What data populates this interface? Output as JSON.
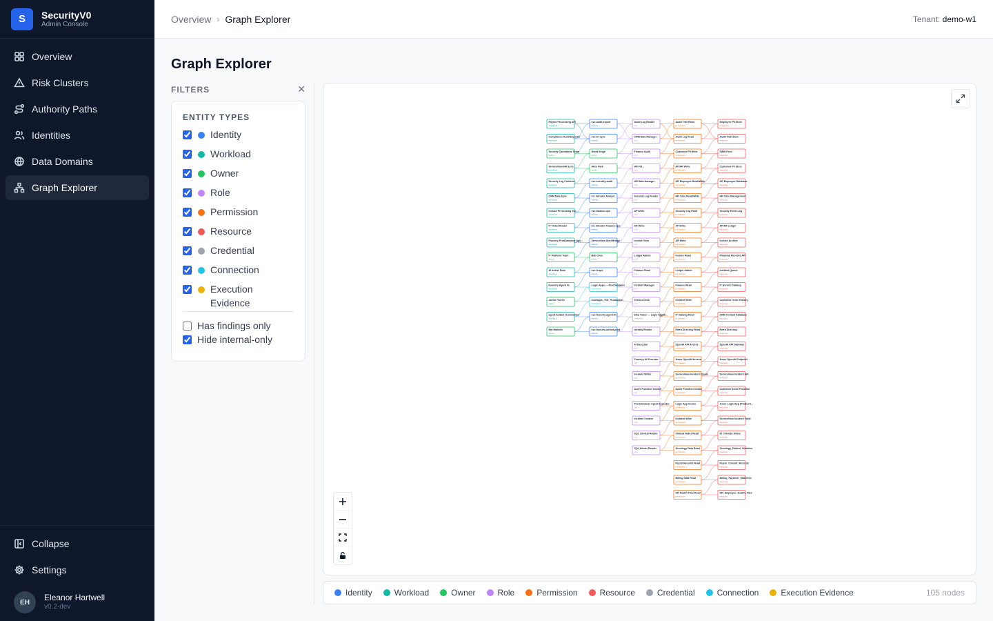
{
  "brand": {
    "logo_letter": "S",
    "name": "SecurityV0",
    "subtitle": "Admin Console"
  },
  "nav": [
    {
      "label": "Overview",
      "icon": "grid-icon",
      "active": false
    },
    {
      "label": "Risk Clusters",
      "icon": "warning-triangle-icon",
      "active": false
    },
    {
      "label": "Authority Paths",
      "icon": "route-icon",
      "active": false
    },
    {
      "label": "Identities",
      "icon": "users-icon",
      "active": false
    },
    {
      "label": "Data Domains",
      "icon": "globe-icon",
      "active": false
    },
    {
      "label": "Graph Explorer",
      "icon": "graph-icon",
      "active": true
    }
  ],
  "sidebar_bottom": {
    "collapse": "Collapse",
    "settings": "Settings"
  },
  "user": {
    "initials": "EH",
    "name": "Eleanor Hartwell",
    "version": "v0.2-dev"
  },
  "header": {
    "breadcrumb_root": "Overview",
    "breadcrumb_current": "Graph Explorer",
    "tenant_label": "Tenant:",
    "tenant_value": "demo-w1"
  },
  "page": {
    "title": "Graph Explorer"
  },
  "filters": {
    "title": "FILTERS",
    "entity_types_title": "ENTITY TYPES",
    "types": [
      {
        "label": "Identity",
        "color": "#3b82f6",
        "checked": true
      },
      {
        "label": "Workload",
        "color": "#14b8a6",
        "checked": true
      },
      {
        "label": "Owner",
        "color": "#22c55e",
        "checked": true
      },
      {
        "label": "Role",
        "color": "#c084fc",
        "checked": true
      },
      {
        "label": "Permission",
        "color": "#f97316",
        "checked": true
      },
      {
        "label": "Resource",
        "color": "#f05a5a",
        "checked": true
      },
      {
        "label": "Credential",
        "color": "#9ca3af",
        "checked": true
      },
      {
        "label": "Connection",
        "color": "#22c3e6",
        "checked": true
      },
      {
        "label": "Execution Evidence",
        "color": "#eab308",
        "checked": true
      }
    ],
    "has_findings_only": {
      "label": "Has findings only",
      "checked": false
    },
    "hide_internal_only": {
      "label": "Hide internal-only",
      "checked": true
    }
  },
  "legend": {
    "items": [
      {
        "label": "Identity",
        "color": "#3b82f6"
      },
      {
        "label": "Workload",
        "color": "#14b8a6"
      },
      {
        "label": "Owner",
        "color": "#22c55e"
      },
      {
        "label": "Role",
        "color": "#c084fc"
      },
      {
        "label": "Permission",
        "color": "#f97316"
      },
      {
        "label": "Resource",
        "color": "#f05a5a"
      },
      {
        "label": "Credential",
        "color": "#9ca3af"
      },
      {
        "label": "Connection",
        "color": "#22c3e6"
      },
      {
        "label": "Execution Evidence",
        "color": "#eab308"
      }
    ],
    "node_count": "105 nodes"
  },
  "graph": {
    "nodes": [
      {
        "label": "Payroll Processing API",
        "type": "Workload"
      },
      {
        "label": "Compliance Audit Exporter",
        "type": "Workload"
      },
      {
        "label": "Security Operations Team",
        "type": "Owner"
      },
      {
        "label": "ServiceNow HR Sync",
        "type": "Workload"
      },
      {
        "label": "Employee PII Store",
        "type": "Resource"
      },
      {
        "label": "Security Log Collector",
        "type": "Workload"
      },
      {
        "label": "svc-audit-export",
        "type": "Identity"
      },
      {
        "label": "CRM Data Sync",
        "type": "Workload"
      },
      {
        "label": "svc-hr-sync",
        "type": "Identity"
      },
      {
        "label": "Grant Singh",
        "type": "Owner"
      },
      {
        "label": "Alice Park",
        "type": "Owner"
      },
      {
        "label": "svc-security-audit",
        "type": "Identity"
      },
      {
        "label": "Audit Log Reader",
        "type": "Role"
      },
      {
        "label": "CRM Data Manager",
        "type": "Role"
      },
      {
        "label": "Finance Audit",
        "type": "Role"
      },
      {
        "label": "HR Filt...",
        "type": "Role"
      },
      {
        "label": "HR Data Manager",
        "type": "Role"
      },
      {
        "label": "int. Intruder Analyst",
        "type": "Identity"
      },
      {
        "label": "Security Log Reader",
        "type": "Role"
      },
      {
        "label": "Audit Trail Read",
        "type": "Permission"
      },
      {
        "label": "Audit Log Read",
        "type": "Permission"
      },
      {
        "label": "Customer PII Write",
        "type": "Permission"
      },
      {
        "label": "AP/AR Write",
        "type": "Permission"
      },
      {
        "label": "HR Employee Read/Write",
        "type": "Permission"
      },
      {
        "label": "HR Case Read/Write",
        "type": "Permission"
      },
      {
        "label": "Security Log Read",
        "type": "Permission"
      },
      {
        "label": "Audit Trail Store",
        "type": "Resource"
      },
      {
        "label": "SIEM Feed",
        "type": "Resource"
      },
      {
        "label": "Customer PII Store",
        "type": "Resource"
      },
      {
        "label": "HR Employee Database",
        "type": "Resource"
      },
      {
        "label": "HR Case Management",
        "type": "Resource"
      },
      {
        "label": "Security Event Log",
        "type": "Resource"
      },
      {
        "label": "AP/AR Ledger",
        "type": "Resource"
      },
      {
        "label": "Invoice Processing Svc",
        "type": "Workload"
      },
      {
        "label": "svc-finance-ops",
        "type": "Identity"
      },
      {
        "label": "AP Write",
        "type": "Role"
      },
      {
        "label": "AR Write",
        "type": "Role"
      },
      {
        "label": "Invoice View",
        "type": "Role"
      },
      {
        "label": "int. Intruder Finance-ops",
        "type": "Identity"
      },
      {
        "label": "Ledger Admin",
        "type": "Role"
      },
      {
        "label": "Finance Read",
        "type": "Role"
      },
      {
        "label": "AP Write",
        "type": "Permission"
      },
      {
        "label": "AR Write",
        "type": "Permission"
      },
      {
        "label": "Invoice Read",
        "type": "Permission"
      },
      {
        "label": "Ledger Admin",
        "type": "Permission"
      },
      {
        "label": "Finance Read",
        "type": "Permission"
      },
      {
        "label": "Invoice Archive",
        "type": "Resource"
      },
      {
        "label": "Financial Records API",
        "type": "Resource"
      },
      {
        "label": "IT Ticket Router",
        "type": "Workload"
      },
      {
        "label": "ServiceNow Alert Bridge",
        "type": "Identity"
      },
      {
        "label": "Bob Chen",
        "type": "Owner"
      },
      {
        "label": "svc-it-ops",
        "type": "Identity"
      },
      {
        "label": "Incident Manager",
        "type": "Role"
      },
      {
        "label": "Service Desk",
        "type": "Role"
      },
      {
        "label": "Incident Write",
        "type": "Permission"
      },
      {
        "label": "IT Catalog Read",
        "type": "Permission"
      },
      {
        "label": "Incident Queue",
        "type": "Resource"
      },
      {
        "label": "IT Service Catalog",
        "type": "Resource"
      },
      {
        "label": "Logic Apps — ProdJamlaser",
        "type": "Connection"
      },
      {
        "label": "SAS Token — Logic AppBl...",
        "type": "Credential"
      },
      {
        "label": "Foundry ProdJamlaser Age...",
        "type": "Workload"
      },
      {
        "label": "IT Platform Team",
        "type": "Owner"
      },
      {
        "label": "AI Assist Flow",
        "type": "Workload"
      },
      {
        "label": "Identity Reader",
        "type": "Role"
      },
      {
        "label": "Customer Order History",
        "type": "Resource"
      },
      {
        "label": "CRM Contact Database",
        "type": "Resource"
      },
      {
        "label": "Coolapps_Tldr_Production",
        "type": "Connection"
      },
      {
        "label": "svc-foundry-agent-01",
        "type": "Identity"
      },
      {
        "label": "AI Executor",
        "type": "Role"
      },
      {
        "label": "Foundry Agent 01",
        "type": "Workload"
      },
      {
        "label": "Janine Torres",
        "type": "Owner"
      },
      {
        "label": "Entra Directory Read",
        "type": "Permission"
      },
      {
        "label": "Foundry AI Executor",
        "type": "Role"
      },
      {
        "label": "Incident Writer",
        "type": "Role"
      },
      {
        "label": "Azure Function Invoker",
        "type": "Role"
      },
      {
        "label": "ProdJamlaser Agent Executor",
        "type": "Role"
      },
      {
        "label": "Incident Creator",
        "type": "Role"
      },
      {
        "label": "OpenAI API Access",
        "type": "Permission"
      },
      {
        "label": "Entra Directory",
        "type": "Resource"
      },
      {
        "label": "Azure OpenAI Access",
        "type": "Permission"
      },
      {
        "label": "ServiceNow Incident Create",
        "type": "Permission"
      },
      {
        "label": "Azure Function Invoke",
        "type": "Permission"
      },
      {
        "label": "Logic App Invoke",
        "type": "Permission"
      },
      {
        "label": "Incident Write",
        "type": "Permission"
      },
      {
        "label": "OpenAI API Gateway",
        "type": "Resource"
      },
      {
        "label": "Azure OpenAI Endpoint",
        "type": "Resource"
      },
      {
        "label": "ServiceNow Incident API",
        "type": "Resource"
      },
      {
        "label": "Customer Azure Function",
        "type": "Resource"
      },
      {
        "label": "Azure Logic App (Producti...",
        "type": "Resource"
      },
      {
        "label": "ServiceNow Incident Table",
        "type": "Resource"
      },
      {
        "label": "agent-AzrBot_Summarizer",
        "type": "Workload"
      },
      {
        "label": "Mal Mallorie",
        "type": "Owner"
      },
      {
        "label": "svc-foundry-azrbot-prod",
        "type": "Identity"
      },
      {
        "label": "SQL Clinical Reader",
        "type": "Role"
      },
      {
        "label": "SQL Admin Reader",
        "type": "Role"
      },
      {
        "label": "Clinical Notes Read",
        "type": "Permission"
      },
      {
        "label": "Oncology Data Read",
        "type": "Permission"
      },
      {
        "label": "Psych Records Read",
        "type": "Permission"
      },
      {
        "label": "Billing Data Read",
        "type": "Permission"
      },
      {
        "label": "HR Health Files Read",
        "type": "Permission"
      },
      {
        "label": "Dl_Clinical_Notes",
        "type": "Resource"
      },
      {
        "label": "Oncology_Patient_Histories",
        "type": "Resource"
      },
      {
        "label": "Psych_Consult_Records",
        "type": "Resource"
      },
      {
        "label": "Billing_Payment_Statemen",
        "type": "Resource"
      },
      {
        "label": "HR_Employee_Health_Files",
        "type": "Resource"
      }
    ]
  }
}
